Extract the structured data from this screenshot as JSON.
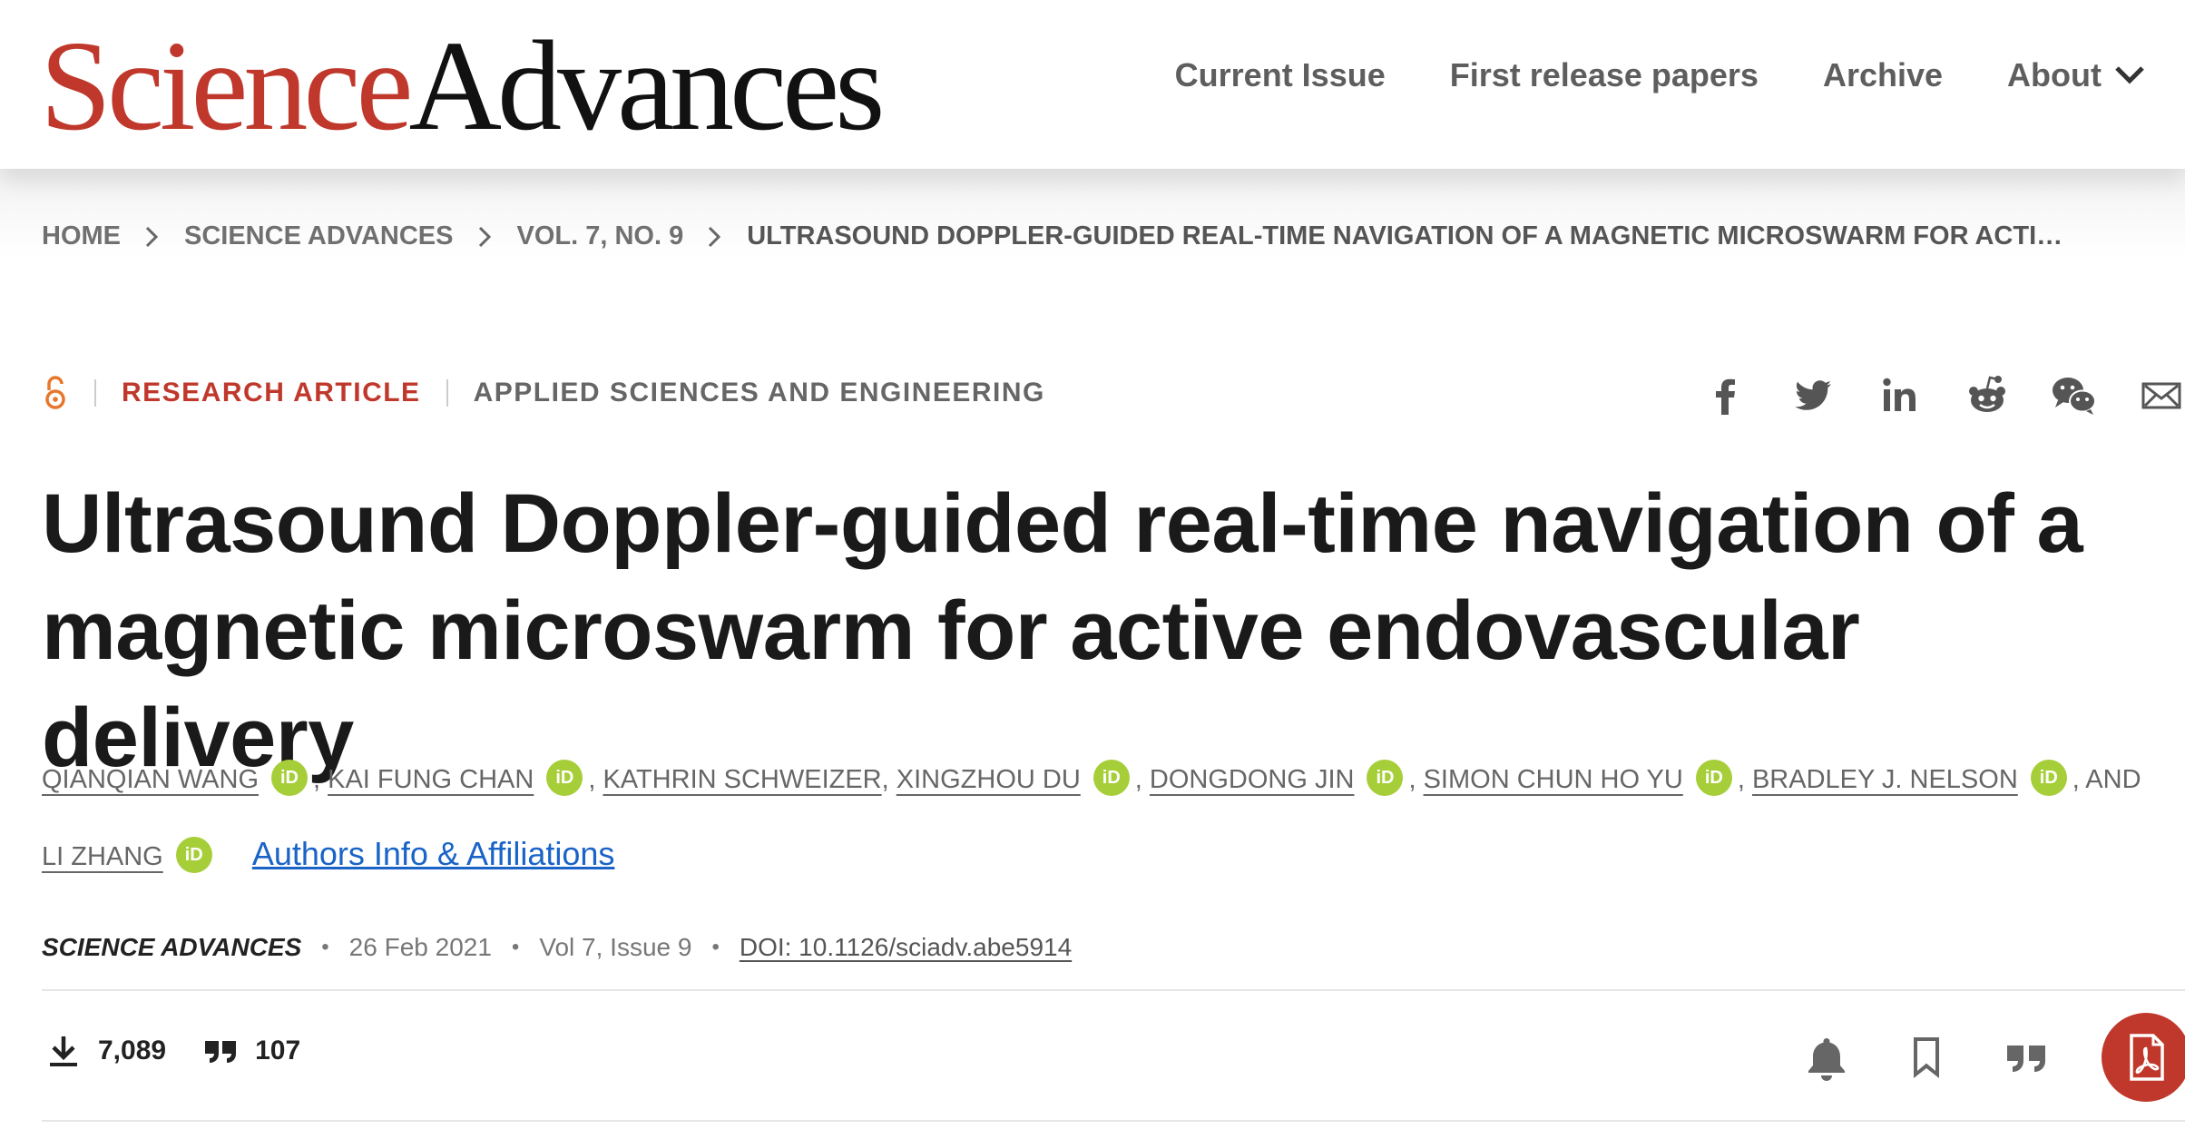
{
  "header": {
    "logo": {
      "part1": "Science",
      "part2": "Advances"
    },
    "nav": [
      {
        "label": "Current Issue"
      },
      {
        "label": "First release papers"
      },
      {
        "label": "Archive"
      },
      {
        "label": "About"
      }
    ]
  },
  "breadcrumb": {
    "items": [
      "HOME",
      "SCIENCE ADVANCES",
      "VOL. 7, NO. 9"
    ],
    "current": "ULTRASOUND DOPPLER-GUIDED REAL-TIME NAVIGATION OF A MAGNETIC MICROSWARM FOR ACTIVE…"
  },
  "article": {
    "type": "RESEARCH ARTICLE",
    "discipline": "APPLIED SCIENCES AND ENGINEERING",
    "title": "Ultrasound Doppler-guided real-time navigation of a magnetic microswarm for active endovascular delivery",
    "authors": [
      "QIANQIAN WANG",
      "KAI FUNG CHAN",
      "KATHRIN SCHWEIZER",
      "XINGZHOU DU",
      "DONGDONG JIN",
      "SIMON CHUN HO YU",
      "BRADLEY J. NELSON",
      "LI ZHANG"
    ],
    "orcid_label": "iD",
    "and_label": "AND",
    "affiliations_link": "Authors Info & Affiliations",
    "journal": "SCIENCE ADVANCES",
    "date": "26 Feb 2021",
    "volume_issue": "Vol 7, Issue 9",
    "doi": "DOI: 10.1126/sciadv.abe5914"
  },
  "metrics": {
    "downloads": "7,089",
    "citations": "107"
  },
  "share_icons": [
    "facebook-icon",
    "twitter-icon",
    "linkedin-icon",
    "reddit-icon",
    "wechat-icon",
    "email-icon"
  ],
  "action_icons": [
    "bell-icon",
    "bookmark-icon",
    "quote-icon",
    "pdf-icon"
  ],
  "colors": {
    "brand_red": "#c0382b",
    "orcid_green": "#a6ce39",
    "link_blue": "#1a63c7"
  }
}
